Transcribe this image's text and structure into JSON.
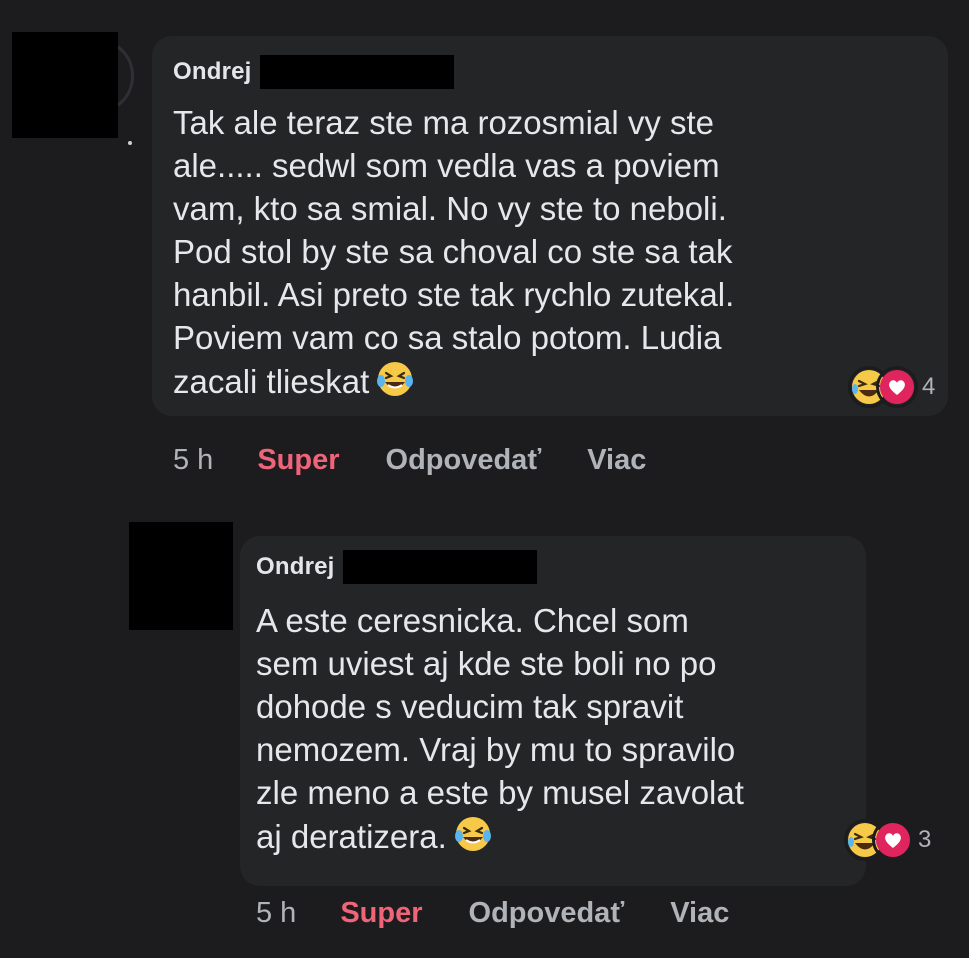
{
  "comments": [
    {
      "author": "Ondrej",
      "text": "Tak ale teraz ste ma rozosmial vy ste\nale..... sedwl som vedla vas a poviem\nvam, kto sa smial. No vy ste to neboli.\nPod stol by ste sa choval co ste sa tak\nhanbil. Asi preto ste tak rychlo zutekal.\nPoviem vam co sa stalo potom. Ludia\nzacali tlieskat",
      "reaction_count": "4",
      "reactions": [
        "laugh-emoji",
        "love-heart"
      ],
      "time": "5 h",
      "like_label": "Super",
      "reply_label": "Odpovedať",
      "more_label": "Viac"
    },
    {
      "author": "Ondrej",
      "text": "A este ceresnicka. Chcel som\nsem uviest aj kde ste boli no po\ndohode s veducim tak spravit\nnemozem. Vraj by mu to spravilo\nzle meno a este by musel zavolat\naj deratizera.",
      "reaction_count": "3",
      "reactions": [
        "laugh-emoji",
        "love-heart"
      ],
      "time": "5 h",
      "like_label": "Super",
      "reply_label": "Odpovedať",
      "more_label": "Viac"
    }
  ],
  "colors": {
    "background": "#1c1c1e",
    "bubble": "#242527",
    "like_active": "#f0647a",
    "secondary_text": "#b0b3b8"
  }
}
